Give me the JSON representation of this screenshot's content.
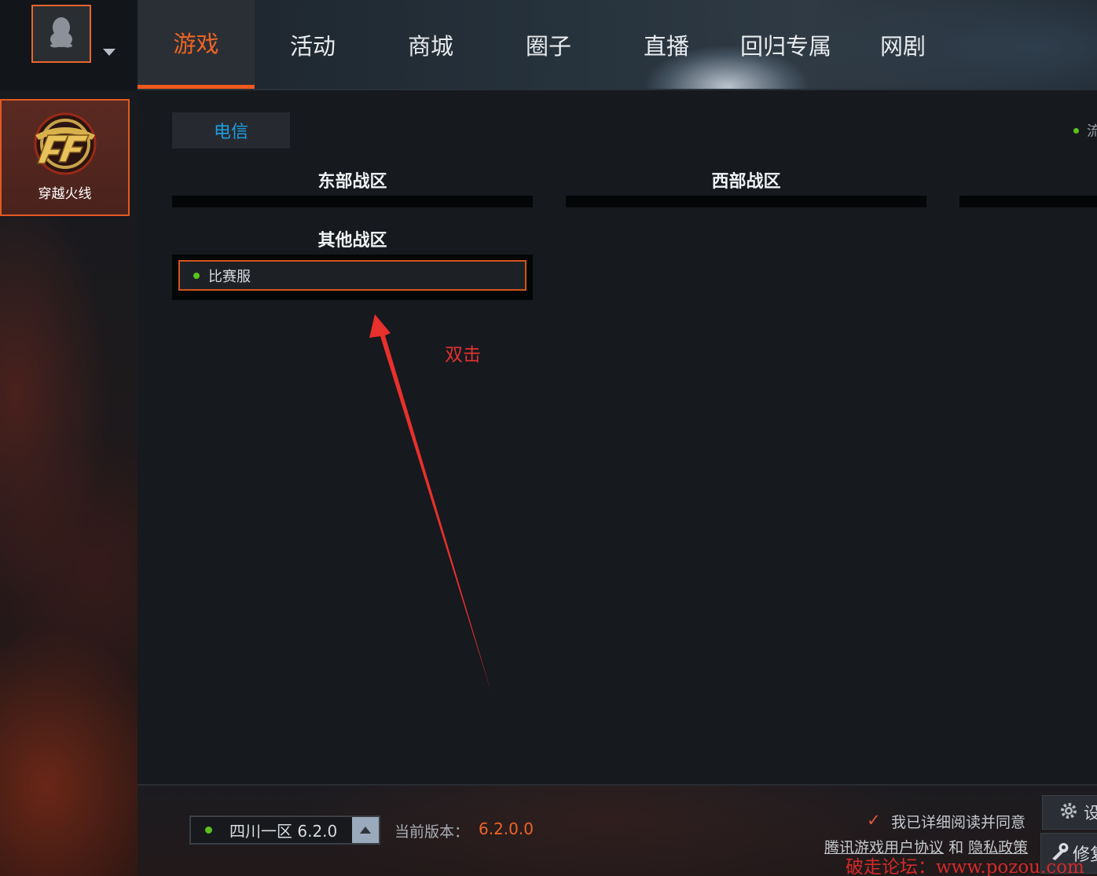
{
  "sidebar": {
    "game_tile": {
      "label": "穿越火线",
      "icon": "cf-logo"
    },
    "avatar_icon": "penguin-icon"
  },
  "topnav": {
    "tabs": [
      {
        "label": "游戏",
        "active": true
      },
      {
        "label": "活动",
        "active": false
      },
      {
        "label": "商城",
        "active": false
      },
      {
        "label": "圈子",
        "active": false
      },
      {
        "label": "直播",
        "active": false
      },
      {
        "label": "回归专属",
        "active": false
      },
      {
        "label": "网剧",
        "active": false
      }
    ]
  },
  "main": {
    "isp_tab": "电信",
    "status_text_right": "流",
    "zones": {
      "east": "东部战区",
      "west": "西部战区",
      "other": "其他战区"
    },
    "other_servers": [
      {
        "label": "比赛服",
        "status": "online"
      }
    ],
    "annotation": "双击"
  },
  "bottombar": {
    "selected_server": "四川一区 6.2.0",
    "version_label": "当前版本：",
    "version_value": "6.2.0.0",
    "agree_text": "我已详细阅读并同意",
    "user_agreement_link": "腾讯游戏用户协议",
    "and_text": "和",
    "privacy_link": "隐私政策",
    "settings_label": "设",
    "repair_label": "修复"
  },
  "watermark": "破走论坛：www.pozou.com",
  "colors": {
    "accent_orange": "#ee6424",
    "isp_blue": "#1e9ee0",
    "online_green": "#5ac21e",
    "annotation_red": "#e0322e"
  }
}
